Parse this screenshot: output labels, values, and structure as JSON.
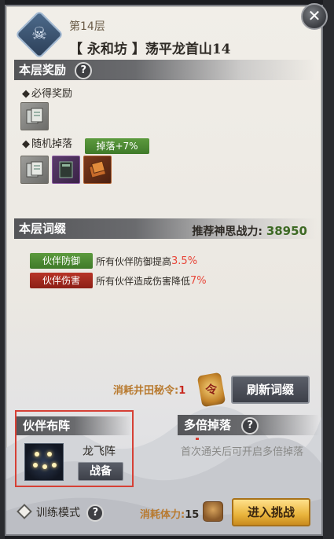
{
  "header": {
    "floor_label": "第14层",
    "title": "【 永和坊 】荡平龙首山14",
    "floor_icon": "skull-icon",
    "close_icon": "close-icon"
  },
  "rewards": {
    "section_title": "本层奖励",
    "guaranteed_label": "必得奖励",
    "random_label": "随机掉落",
    "drop_bonus": "掉落+7%",
    "guaranteed_items": [
      {
        "icon": "book-item-icon",
        "rarity": "grey"
      }
    ],
    "random_items": [
      {
        "icon": "book-item-icon",
        "rarity": "grey"
      },
      {
        "icon": "scroll-item-icon",
        "rarity": "purple"
      },
      {
        "icon": "manual-item-icon",
        "rarity": "orange"
      }
    ]
  },
  "affixes": {
    "section_title": "本层词缀",
    "recommend_label": "推荐神思战力:",
    "recommend_value": "38950",
    "items": [
      {
        "tag": "伙伴防御",
        "text": "所有伙伴防御提高",
        "value": "3.5%",
        "color": "#4f8a34"
      },
      {
        "tag": "伙伴伤害",
        "text": "所有伙伴造成伤害降低",
        "value": "7%",
        "color": "#a42a1e"
      }
    ]
  },
  "refresh": {
    "cost_label": "消耗井田秘令:",
    "cost_value": "1",
    "token_glyph": "令",
    "button_label": "刷新词缀"
  },
  "formation": {
    "title": "伙伴布阵",
    "name": "龙飞阵",
    "button_label": "战备"
  },
  "multi_drop": {
    "title": "多倍掉落",
    "note": "首次通关后可开启多倍掉落"
  },
  "footer": {
    "training_mode": "训练模式",
    "stamina_label": "消耗体力:",
    "stamina_value": "15",
    "enter_button": "进入挑战"
  },
  "colors": {
    "accent_green": "#4f8a34",
    "accent_red": "#d64035",
    "gold_button": "#e9b43c",
    "value_green": "#3e6a25"
  }
}
